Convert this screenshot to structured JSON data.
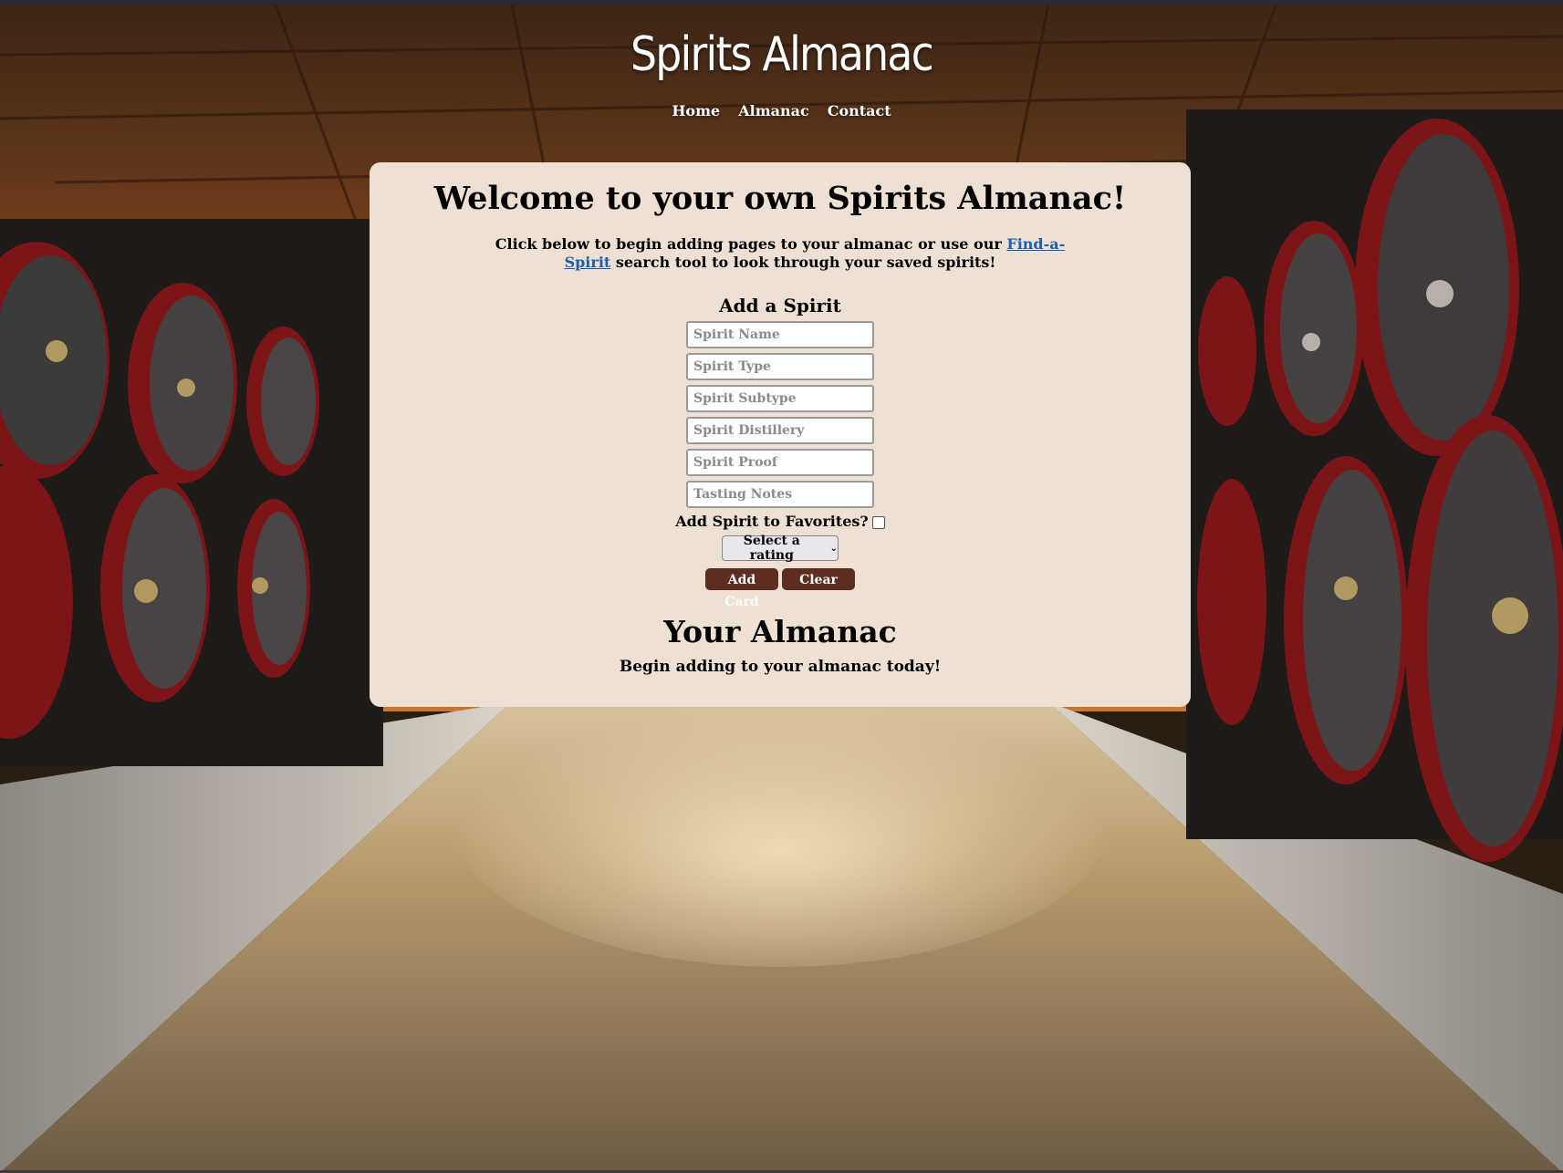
{
  "site": {
    "title": "Spirits Almanac",
    "nav": [
      "Home",
      "Almanac",
      "Contact"
    ]
  },
  "card": {
    "welcome": "Welcome to your own Spirits Almanac!",
    "intro_before": "Click below to begin adding pages to your almanac or use our ",
    "intro_link": "Find-a-Spirit",
    "intro_after": " search tool to look through your saved spirits!",
    "form": {
      "heading": "Add a Spirit",
      "placeholders": {
        "name": "Spirit Name",
        "type": "Spirit Type",
        "subtype": "Spirit Subtype",
        "distillery": "Spirit Distillery",
        "proof": "Spirit Proof",
        "notes": "Tasting Notes"
      },
      "favorites_label": "Add Spirit to Favorites?",
      "favorites_checked": false,
      "rating_selected": "Select a rating",
      "add_label": "Add Card",
      "clear_label": "Clear"
    },
    "almanac_heading": "Your Almanac",
    "almanac_empty": "Begin adding to your almanac today!"
  },
  "colors": {
    "card_bg": "#efe0d4",
    "button_bg": "#5d2d22",
    "link": "#1a5fb4"
  }
}
